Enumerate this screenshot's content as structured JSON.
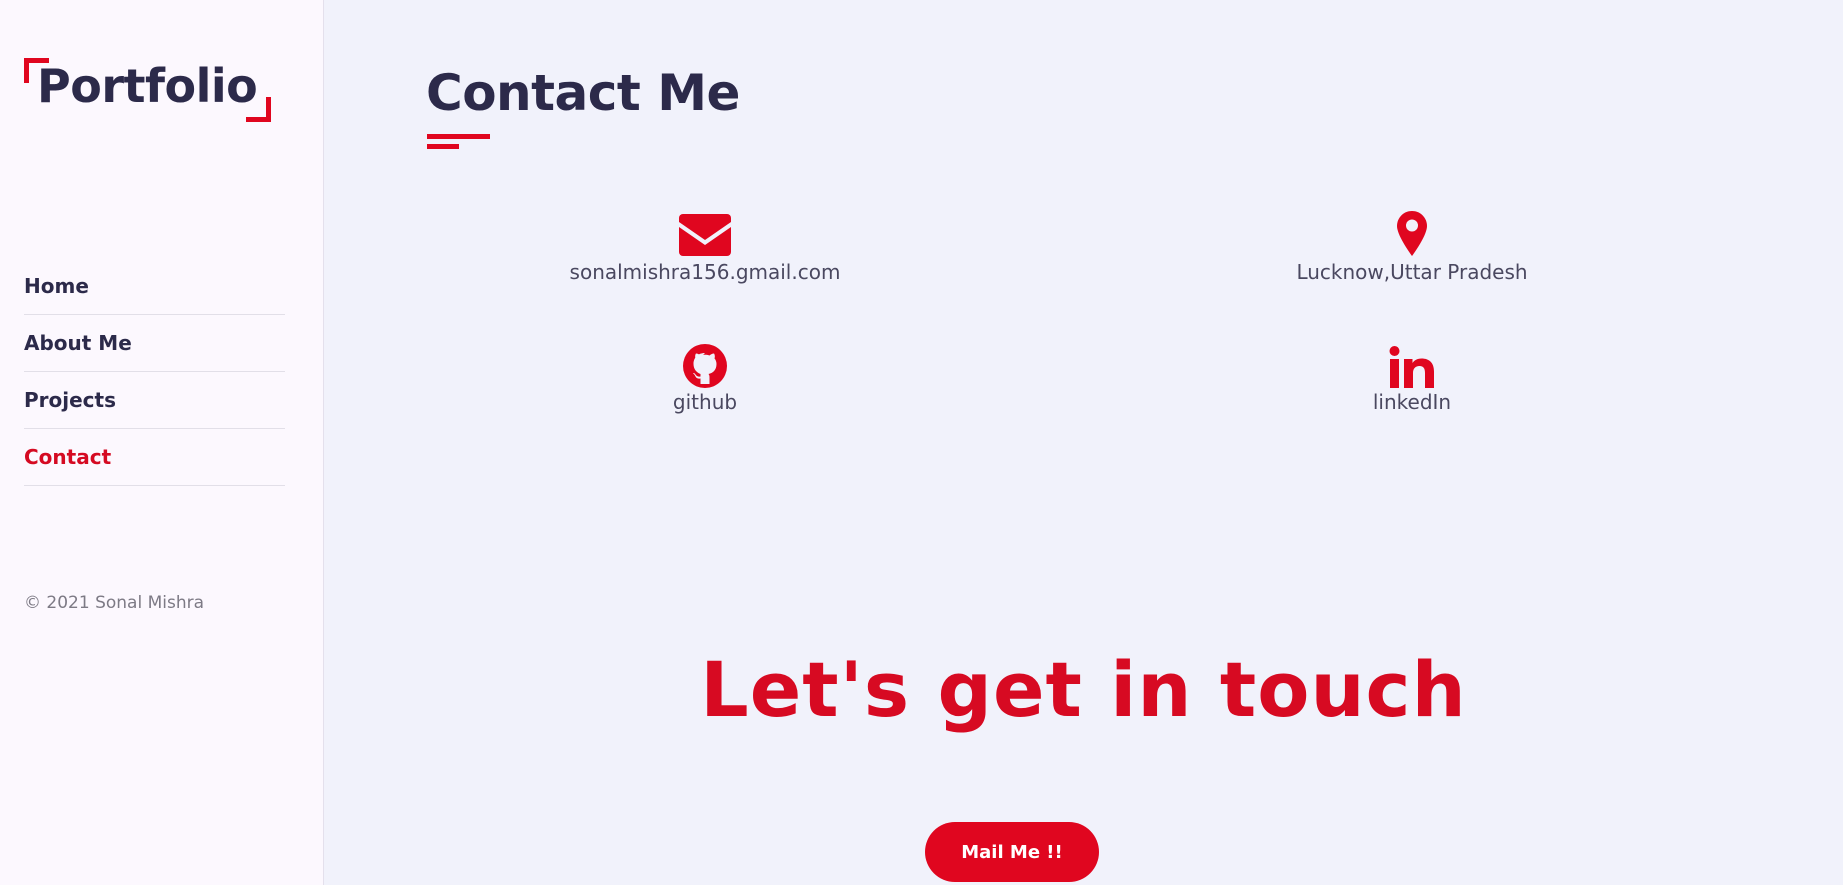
{
  "sidebar": {
    "logo": "Portfolio",
    "nav": [
      {
        "label": "Home",
        "active": false
      },
      {
        "label": "About Me",
        "active": false
      },
      {
        "label": "Projects",
        "active": false
      },
      {
        "label": "Contact",
        "active": true
      }
    ],
    "copyright": "© 2021 Sonal Mishra"
  },
  "main": {
    "title": "Contact Me",
    "contacts": [
      {
        "icon": "envelope-icon",
        "label": "sonalmishra156.gmail.com"
      },
      {
        "icon": "map-pin-icon",
        "label": "Lucknow,Uttar Pradesh"
      },
      {
        "icon": "github-icon",
        "label": "github"
      },
      {
        "icon": "linkedin-icon",
        "label": "linkedIn"
      }
    ],
    "tagline": "Let's get in touch",
    "mail_button": "Mail Me !!"
  },
  "colors": {
    "accent": "#e0061f",
    "text_dark": "#2c2a4a",
    "main_bg": "#f1f2fb",
    "sidebar_bg": "#fcf8fe"
  }
}
